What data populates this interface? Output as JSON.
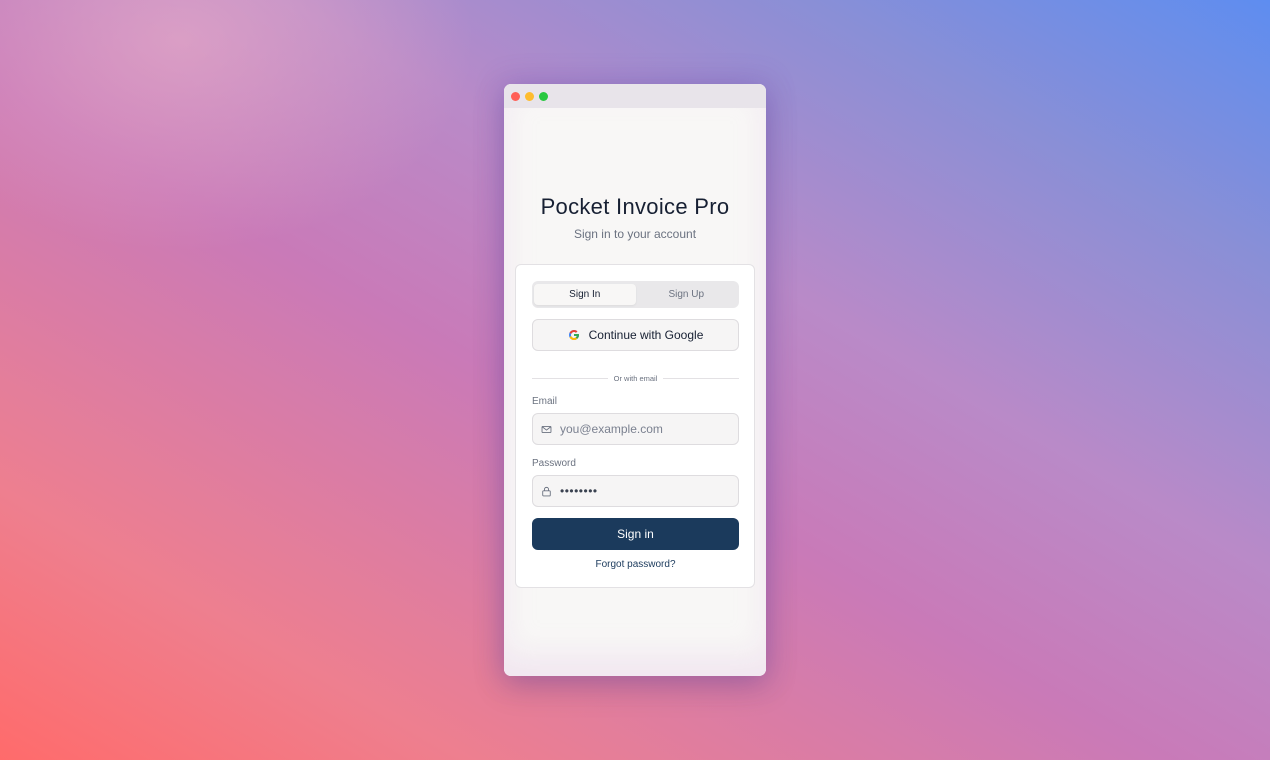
{
  "window": {
    "traffic_lights": [
      "close",
      "minimize",
      "zoom"
    ]
  },
  "header": {
    "title": "Pocket Invoice Pro",
    "subtitle": "Sign in to your account"
  },
  "tabs": {
    "items": [
      {
        "label": "Sign In",
        "active": true
      },
      {
        "label": "Sign Up",
        "active": false
      }
    ]
  },
  "google": {
    "label": "Continue with Google",
    "icon": "google-icon"
  },
  "divider": {
    "text": "Or with email"
  },
  "email": {
    "label": "Email",
    "placeholder": "you@example.com",
    "value": "",
    "icon": "mail-icon"
  },
  "password": {
    "label": "Password",
    "value": "••••••••",
    "icon": "lock-icon"
  },
  "actions": {
    "submit_label": "Sign in",
    "forgot_label": "Forgot password?"
  },
  "colors": {
    "primary": "#1b3a5c",
    "title_text": "#172033",
    "muted_text": "#6b7280"
  }
}
